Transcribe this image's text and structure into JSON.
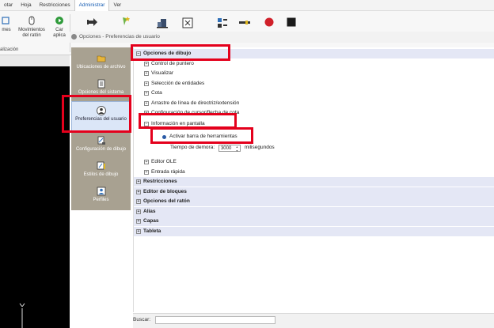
{
  "menubar": {
    "items": [
      "otar",
      "Hoja",
      "Restricciones",
      "Administrar",
      "Ver"
    ],
    "active_index": 3
  },
  "ribbon": {
    "buttons": [
      {
        "label": "mes",
        "icon": "frames-icon"
      },
      {
        "label": "Movimientos del ratón",
        "icon": "mouse-icon"
      },
      {
        "label": "Car aplica",
        "icon": "play-icon"
      }
    ],
    "panel_label": "alización",
    "extra_icons": [
      "arrow-right-icon",
      "sparkle-icon",
      "building-icon",
      "excel-icon",
      "properties-icon",
      "line-icon",
      "record-icon",
      "stop-icon"
    ],
    "record_color": "#d0202a",
    "stop_color": "#1a1a1a"
  },
  "dialog": {
    "title": "Opciones - Preferencias de usuario"
  },
  "categories": [
    {
      "label": "Ubicaciones de archivo",
      "icon": "folder-icon"
    },
    {
      "label": "Opciones del sistema",
      "icon": "system-options-icon"
    },
    {
      "label": "Preferencias del usuario",
      "icon": "user-preferences-icon",
      "selected": true
    },
    {
      "label": "Configuración de dibujo",
      "icon": "drawing-config-icon"
    },
    {
      "label": "Estilos de dibujo",
      "icon": "drawing-styles-icon"
    },
    {
      "label": "Perfiles",
      "icon": "profiles-icon"
    }
  ],
  "tree": {
    "rows": [
      {
        "label": "Opciones de dibujo",
        "level": 0,
        "expander": "−",
        "top": true
      },
      {
        "label": "Control de puntero",
        "level": 1,
        "expander": "+"
      },
      {
        "label": "Visualizar",
        "level": 1,
        "expander": "+"
      },
      {
        "label": "Selección de entidades",
        "level": 1,
        "expander": "+"
      },
      {
        "label": "Cota",
        "level": 1,
        "expander": "+"
      },
      {
        "label": "Arrastre de línea de directriz/extensión",
        "level": 1,
        "expander": "+"
      },
      {
        "label": "Configuración de cursor/flecha de cota",
        "level": 1,
        "expander": "+"
      },
      {
        "label": "Información en pantalla",
        "level": 1,
        "expander": "−"
      },
      {
        "label": "Activar barra de herramientas",
        "level": 2,
        "radio": true
      },
      {
        "label": "Tiempo de demora:",
        "level": 2,
        "spinner": "3000",
        "suffix": "milisegundos"
      },
      {
        "label": "Editor OLE",
        "level": 1,
        "expander": "+"
      },
      {
        "label": "Entrada rápida",
        "level": 1,
        "expander": "+"
      },
      {
        "label": "Restricciones",
        "level": 0,
        "expander": "+",
        "top": true
      },
      {
        "label": "Editor de bloques",
        "level": 0,
        "expander": "+",
        "top": true
      },
      {
        "label": "Opciones del ratón",
        "level": 0,
        "expander": "+",
        "top": true
      },
      {
        "label": "Alias",
        "level": 0,
        "expander": "+",
        "top": true
      },
      {
        "label": "Capas",
        "level": 0,
        "expander": "+",
        "top": true
      },
      {
        "label": "Tableta",
        "level": 0,
        "expander": "+",
        "top": true
      }
    ]
  },
  "search": {
    "label": "Buscar:",
    "value": ""
  },
  "canvas": {
    "axis_label": "Y"
  },
  "colors": {
    "highlight": "#e4001c",
    "category_bg": "#a8a191",
    "selected_bg": "#dbe6f7"
  }
}
